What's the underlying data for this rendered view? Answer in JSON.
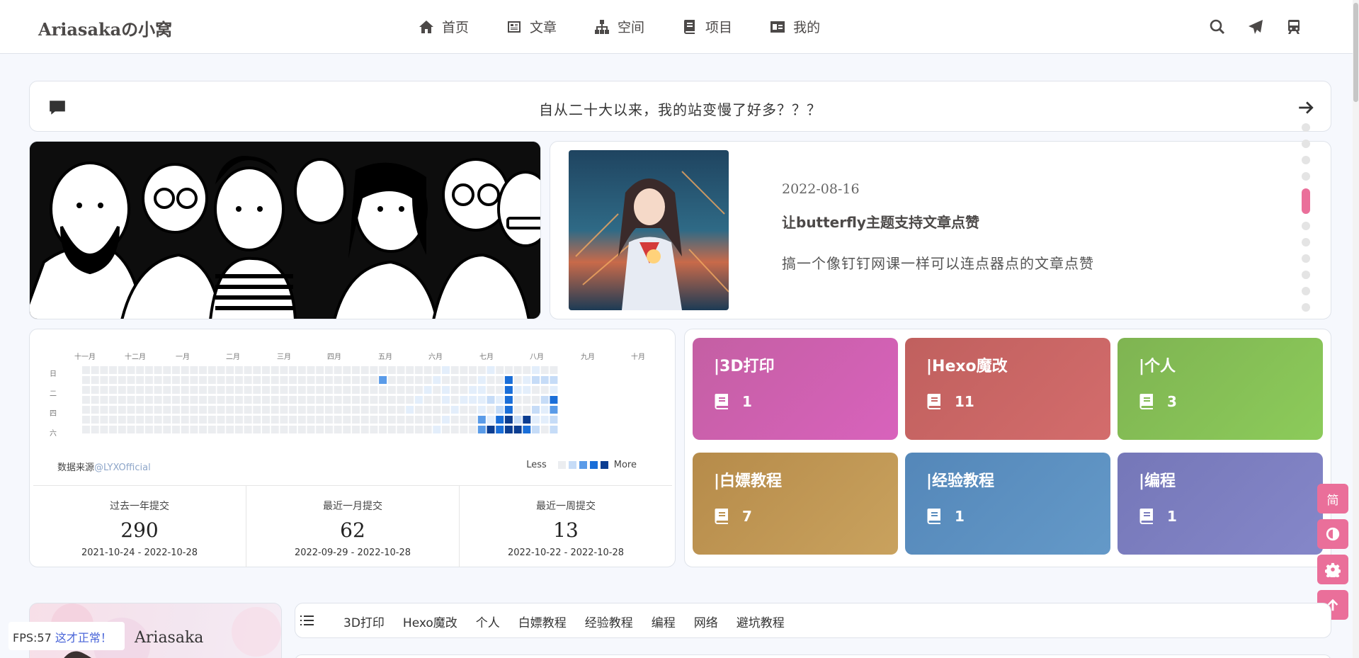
{
  "nav": {
    "brand": "Ariasakaの小窝",
    "menu": [
      {
        "label": "首页",
        "icon": "home-icon"
      },
      {
        "label": "文章",
        "icon": "articles-icon"
      },
      {
        "label": "空间",
        "icon": "sitemap-icon"
      },
      {
        "label": "项目",
        "icon": "book-icon"
      },
      {
        "label": "我的",
        "icon": "id-card-icon"
      }
    ],
    "right_icons": [
      "search-icon",
      "send-icon",
      "train-icon"
    ]
  },
  "notice": {
    "text": "自从二十大以来，我的站变慢了好多？？？",
    "icon": "comment-icon",
    "arrow_icon": "arrow-right-icon"
  },
  "feature": {
    "date": "2022-08-16",
    "title": "让butterfly主题支持文章点赞",
    "description": "搞一个像钉钉网课一样可以连点器点的文章点赞"
  },
  "contrib": {
    "months": [
      "十一月",
      "十二月",
      "一月",
      "二月",
      "三月",
      "四月",
      "五月",
      "六月",
      "七月",
      "八月",
      "九月",
      "十月"
    ],
    "weekdays": [
      "日",
      "二",
      "四",
      "六"
    ],
    "source_label": "数据来源",
    "source_link": "@LYXOfficial",
    "legend_less": "Less",
    "legend_more": "More",
    "stats": [
      {
        "label": "过去一年提交",
        "value": "290",
        "range": "2021-10-24 - 2022-10-28"
      },
      {
        "label": "最近一月提交",
        "value": "62",
        "range": "2022-09-29 - 2022-10-28"
      },
      {
        "label": "最近一周提交",
        "value": "13",
        "range": "2022-10-22 - 2022-10-28"
      }
    ]
  },
  "categories": [
    {
      "name": "|3D打印",
      "count": "1",
      "color_from": "#c45fa3",
      "color_to": "#d862bc"
    },
    {
      "name": "|Hexo魔改",
      "count": "11",
      "color_from": "#c0605e",
      "color_to": "#d36c6c"
    },
    {
      "name": "|个人",
      "count": "3",
      "color_from": "#7fb452",
      "color_to": "#8ccb5a"
    },
    {
      "name": "|白嫖教程",
      "count": "7",
      "color_from": "#b68b4a",
      "color_to": "#c9a25e"
    },
    {
      "name": "|经验教程",
      "count": "1",
      "color_from": "#5487b9",
      "color_to": "#6499c8"
    },
    {
      "name": "|编程",
      "count": "1",
      "color_from": "#7577b8",
      "color_to": "#8587c9"
    }
  ],
  "side_buttons": {
    "lang": "简"
  },
  "author": {
    "name": "Ariasaka"
  },
  "fps": {
    "label": "FPS:57",
    "status": "这才正常！"
  },
  "catbar": {
    "items": [
      "3D打印",
      "Hexo魔改",
      "个人",
      "白嫖教程",
      "经验教程",
      "编程",
      "网络",
      "避坑教程"
    ]
  }
}
